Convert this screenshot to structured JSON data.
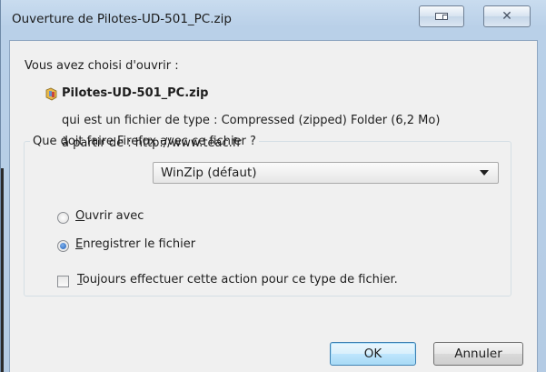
{
  "window": {
    "title": "Ouverture de Pilotes-UD-501_PC.zip",
    "min_icon": "window-restore-icon",
    "close_glyph": "✕"
  },
  "prompt": "Vous avez choisi d'ouvrir :",
  "file": {
    "icon": "zip-file-icon",
    "name": "Pilotes-UD-501_PC.zip",
    "type_line": "qui est un fichier de type : Compressed (zipped) Folder (6,2 Mo)",
    "source_line": "à partir de : http://www.teac.fr"
  },
  "action_group": {
    "legend": "Que doit faire Firefox avec ce fichier ?",
    "open_with": {
      "accel": "O",
      "rest": "uvrir avec",
      "checked": false
    },
    "open_with_app": "WinZip (défaut)",
    "save": {
      "accel": "E",
      "rest": "nregistrer le fichier",
      "checked": true
    },
    "always": {
      "accel": "T",
      "rest": "oujours effectuer cette action pour ce type de fichier.",
      "checked": false
    }
  },
  "buttons": {
    "ok": "OK",
    "cancel": "Annuler"
  }
}
